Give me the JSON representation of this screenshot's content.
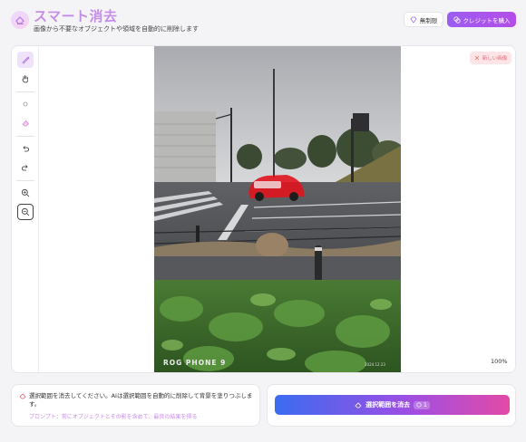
{
  "header": {
    "title": "スマート消去",
    "subtitle": "画像から不要なオブジェクトや領域を自動的に削除します",
    "unlimited_label": "無制限",
    "buy_label": "クレジットを購入"
  },
  "toolbar": {
    "tools": [
      "brush-icon",
      "hand-icon",
      "dot-icon",
      "eraser-icon",
      "undo-icon",
      "redo-icon",
      "zoom-in-icon",
      "zoom-out-icon"
    ],
    "active_tool": "brush-icon"
  },
  "canvas": {
    "new_image_label": "新しい画像",
    "zoom_level": "100%",
    "photo_watermark_left": "ROG PHONE 9",
    "photo_watermark_right": "2024.12.23"
  },
  "hint": {
    "text": "選択範囲を消去してください。AIは選択範囲を自動的に削除して背景を塗りつぶします。",
    "tip": "プロンプト：常にオブジェクトとその影を含めて、最良の結果を得る"
  },
  "action": {
    "erase_label": "選択範囲を消去",
    "credit_cost": "1"
  },
  "colors": {
    "accent": "#9c5cf0",
    "title": "#c58ee6",
    "mask": "#e0141e"
  }
}
